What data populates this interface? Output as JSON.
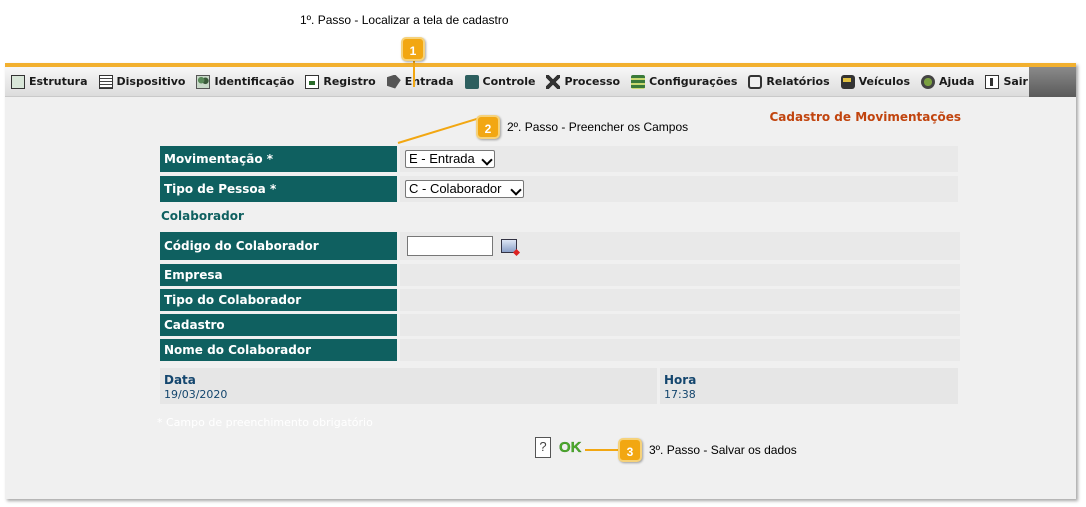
{
  "steps": {
    "step1": {
      "number": "1",
      "text": "1º. Passo - Localizar a tela de cadastro"
    },
    "step2": {
      "number": "2",
      "text": "2º. Passo - Preencher os Campos"
    },
    "step3": {
      "number": "3",
      "text": "3º. Passo - Salvar os dados"
    }
  },
  "menu": [
    {
      "label": "Estrutura",
      "icon": "structure-icon"
    },
    {
      "label": "Dispositivo",
      "icon": "device-icon"
    },
    {
      "label": "Identificação",
      "icon": "identification-icon"
    },
    {
      "label": "Registro",
      "icon": "register-icon"
    },
    {
      "label": "Entrada",
      "icon": "entry-icon"
    },
    {
      "label": "Controle",
      "icon": "control-icon"
    },
    {
      "label": "Processo",
      "icon": "process-icon"
    },
    {
      "label": "Configurações",
      "icon": "settings-icon"
    },
    {
      "label": "Relatórios",
      "icon": "reports-icon"
    },
    {
      "label": "Veículos",
      "icon": "vehicles-icon"
    },
    {
      "label": "Ajuda",
      "icon": "help-icon"
    },
    {
      "label": "Sair",
      "icon": "exit-icon"
    }
  ],
  "form": {
    "title": "Cadastro de Movimentações",
    "movimentacao": {
      "label": "Movimentação *",
      "value": "E - Entrada"
    },
    "tipo_pessoa": {
      "label": "Tipo de Pessoa *",
      "value": "C - Colaborador"
    },
    "section": "Colaborador",
    "codigo": {
      "label": "Código do Colaborador",
      "value": ""
    },
    "empresa": {
      "label": "Empresa",
      "value": ""
    },
    "tipo_colaborador": {
      "label": "Tipo do Colaborador",
      "value": ""
    },
    "cadastro": {
      "label": "Cadastro",
      "value": ""
    },
    "nome": {
      "label": "Nome do Colaborador",
      "value": ""
    },
    "data": {
      "label": "Data",
      "value": "19/03/2020"
    },
    "hora": {
      "label": "Hora",
      "value": "17:38"
    },
    "required_note": "* Campo de preenchimento obrigatório",
    "ok_label": "OK"
  },
  "colors": {
    "accent": "#f2a712",
    "label_bg": "#0f6060",
    "title": "#c1440e",
    "ok": "#4caa2c"
  }
}
